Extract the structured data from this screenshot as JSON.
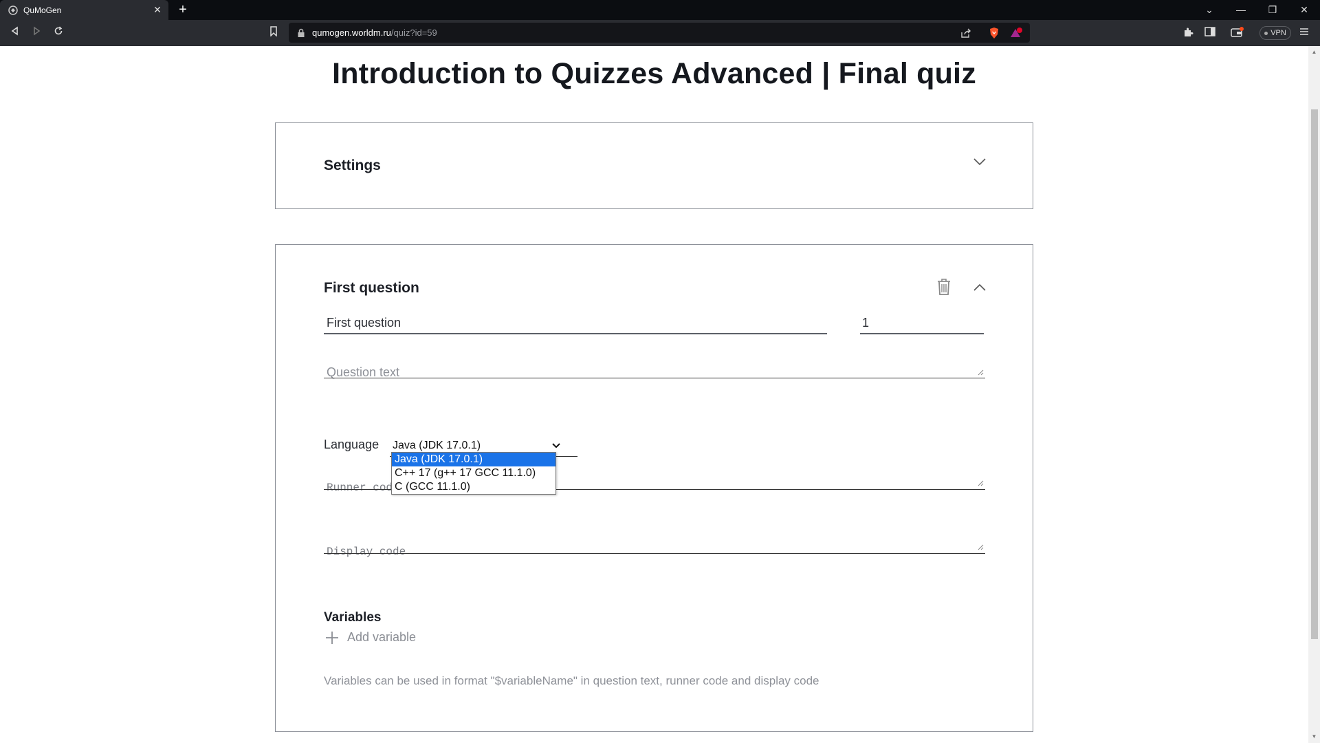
{
  "browser": {
    "tab_title": "QuMoGen",
    "tab_close": "✕",
    "new_tab": "+",
    "url_host": "qumogen.worldm.ru",
    "url_path": "/quiz?id=59",
    "vpn_label": "VPN",
    "window_controls": {
      "minimize": "—",
      "restore": "❐",
      "close": "✕",
      "tabs_menu": "⌄"
    }
  },
  "page": {
    "title": "Introduction to Quizzes Advanced | Final quiz"
  },
  "settings_card": {
    "heading": "Settings"
  },
  "question_card": {
    "heading": "First question",
    "title_value": "First question",
    "points_value": "1",
    "question_text_placeholder": "Question text",
    "language_label": "Language",
    "language_selected": "Java (JDK 17.0.1)",
    "language_options": [
      "Java (JDK 17.0.1)",
      "C++ 17 (g++ 17 GCC 11.1.0)",
      "C (GCC 11.1.0)"
    ],
    "runner_code_placeholder": "Runner code",
    "display_code_placeholder": "Display code",
    "variables_heading": "Variables",
    "add_variable_label": "Add variable",
    "variables_hint": "Variables can be used in format \"$variableName\" in question text, runner code and display code"
  },
  "colors": {
    "chrome_dark": "#0b0d11",
    "toolbar": "#2a2c31",
    "card_border": "#8a8e96",
    "selected_option": "#1a73e8"
  }
}
